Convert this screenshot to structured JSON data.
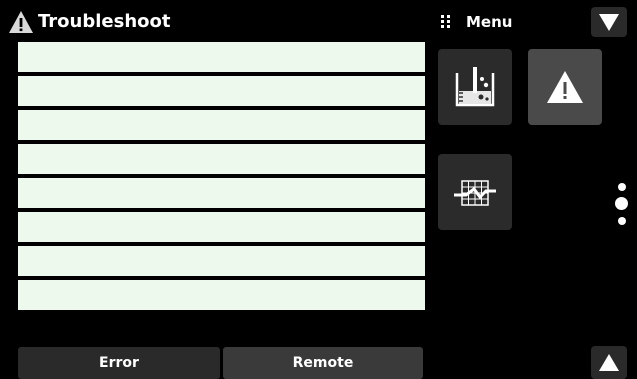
{
  "header": {
    "title": "Troubleshoot",
    "title_icon": "warning-triangle-icon",
    "menu_label": "Menu",
    "menu_icon": "grip-icon",
    "dropdown_icon": "triangle-down-icon"
  },
  "error_list": {
    "rows": [
      "",
      "",
      "",
      "",
      "",
      "",
      "",
      ""
    ]
  },
  "menu": {
    "tiles": [
      {
        "icon": "lab-beaker-icon"
      },
      {
        "icon": "warning-triangle-icon",
        "active": true
      },
      {
        "icon": "chart-grid-icon"
      }
    ],
    "page_indicator": {
      "pages": 3,
      "current": 2
    }
  },
  "footer": {
    "error_label": "Error",
    "remote_label": "Remote",
    "scroll_up_icon": "triangle-up-icon"
  },
  "colors": {
    "background": "#000000",
    "row_fill": "#eef9ee",
    "tile": "#2b2b2b",
    "tile_active": "#4a4a4a"
  }
}
